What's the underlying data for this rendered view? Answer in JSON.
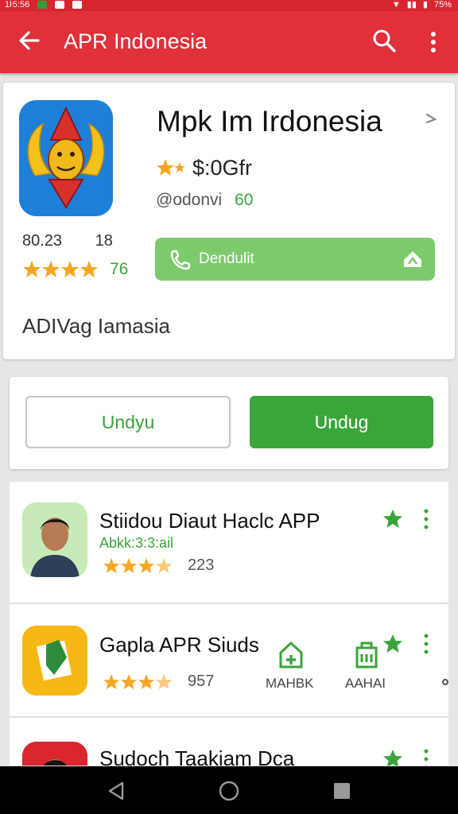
{
  "status_bar": {
    "time": "1ŀ5:56",
    "battery": "75%"
  },
  "app_bar": {
    "title": "APR Indonesia"
  },
  "app_card": {
    "name": "Mpk Im Irdonesia",
    "price": "$:0Gfr",
    "developer": "@odonvi",
    "developer_count": "60",
    "stat_a": "80.23",
    "stat_b": "18",
    "rating_count": "76",
    "download_label": "Dendulit",
    "subtitle": "ADIVag Iamasia"
  },
  "buttons": {
    "outline_label": "Undyu",
    "primary_label": "Undug"
  },
  "list": [
    {
      "title": "Stiidou Diaut Haclc APP",
      "subtitle": "Abkk:3:3:ail",
      "rating_count": "223"
    },
    {
      "title": "Gapla APR Siuds",
      "rating_count": "957",
      "action1_label": "MAHBK",
      "action2_label": "AAHAI"
    },
    {
      "title": "Sudoch Taakiam Dca"
    }
  ],
  "colors": {
    "accent": "#e0303a",
    "green": "#3aa53a",
    "star": "#f5a623"
  }
}
